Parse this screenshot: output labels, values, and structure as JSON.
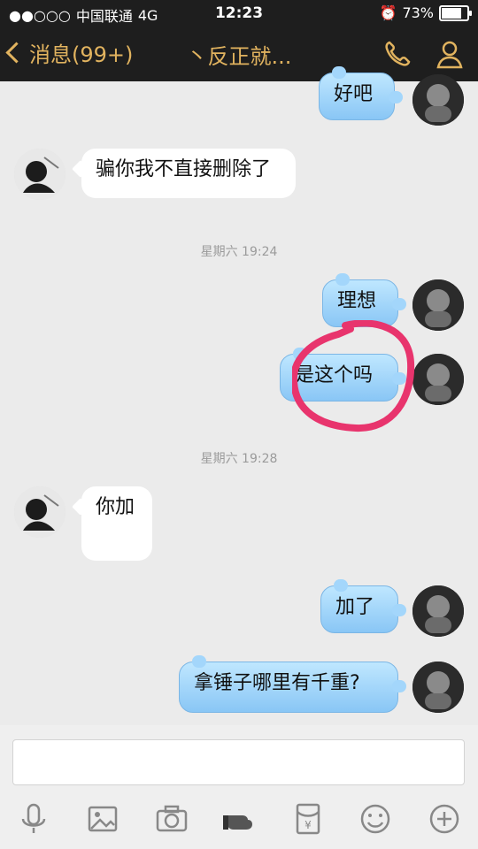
{
  "status_bar": {
    "signal": "●●○○○",
    "carrier": "中国联通",
    "network": "4G",
    "time": "12:23",
    "battery_pct": "73%"
  },
  "nav": {
    "back_label": "消息(99+)",
    "title": "丶反正就..."
  },
  "timestamps": {
    "t1": "星期六 19:24",
    "t2": "星期六 19:28"
  },
  "messages": [
    {
      "side": "out",
      "text": "好吧"
    },
    {
      "side": "in",
      "text": "骗你我不直接删除了"
    },
    {
      "side": "out",
      "text": "理想"
    },
    {
      "side": "out",
      "text": "是这个吗"
    },
    {
      "side": "in",
      "text": "你加"
    },
    {
      "side": "out",
      "text": "加了"
    },
    {
      "side": "out",
      "text": "拿锤子哪里有千重?"
    }
  ],
  "input": {
    "placeholder": ""
  },
  "colors": {
    "accent": "#e1b35f",
    "out_bubble": "#a3d6fb",
    "annotation": "#e8346d"
  }
}
